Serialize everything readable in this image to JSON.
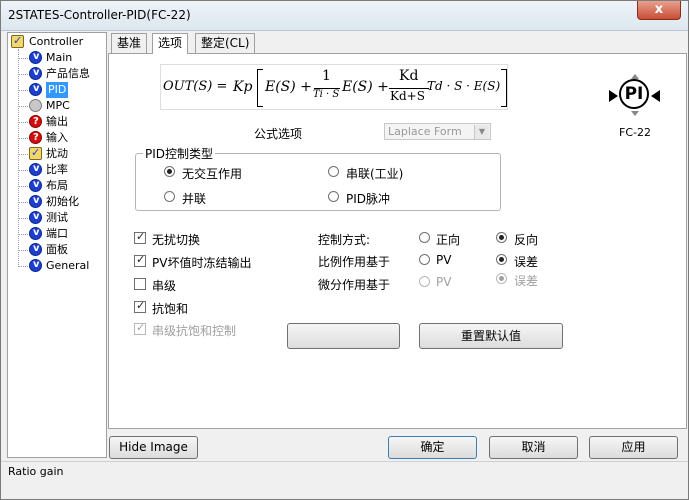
{
  "window": {
    "title": "2STATES-Controller-PID(FC-22)",
    "close_label": "x"
  },
  "tree": {
    "root": "Controller",
    "items": [
      {
        "label": "Main",
        "icon": "check-blue-icon"
      },
      {
        "label": "产品信息",
        "icon": "check-blue-icon"
      },
      {
        "label": "PID",
        "icon": "check-blue-icon",
        "selected": true
      },
      {
        "label": "MPC",
        "icon": "gray-dot-icon"
      },
      {
        "label": "输出",
        "icon": "question-red-icon"
      },
      {
        "label": "输入",
        "icon": "question-red-icon"
      },
      {
        "label": "扰动",
        "icon": "checkbox-icon"
      },
      {
        "label": "比率",
        "icon": "check-blue-icon"
      },
      {
        "label": "布局",
        "icon": "check-blue-icon"
      },
      {
        "label": "初始化",
        "icon": "check-blue-icon"
      },
      {
        "label": "测试",
        "icon": "check-blue-icon"
      },
      {
        "label": "端口",
        "icon": "check-blue-icon"
      },
      {
        "label": "面板",
        "icon": "check-blue-icon"
      },
      {
        "label": "General",
        "icon": "check-blue-icon"
      }
    ]
  },
  "tabs": [
    "基准",
    "选项",
    "整定(CL)"
  ],
  "formula": {
    "lhs": "OUT(S) =",
    "kp": "Kp",
    "e1": "E(S) +",
    "frac1_num": "1",
    "frac1_den": "Ti · S",
    "e2": "E(S) +",
    "frac2_num": "Kd",
    "frac2_den": "Kd+S",
    "tail": "Td · S · E(S)"
  },
  "formula_option": {
    "label": "公式选项",
    "value": "Laplace Form"
  },
  "pid_type": {
    "title": "PID控制类型",
    "options": [
      "无交互作用",
      "串联(工业)",
      "并联",
      "PID脉冲"
    ],
    "selected": "无交互作用"
  },
  "checkboxes": [
    {
      "label": "无扰切换",
      "checked": true,
      "enabled": true
    },
    {
      "label": "PV坏值时冻结输出",
      "checked": true,
      "enabled": true
    },
    {
      "label": "串级",
      "checked": false,
      "enabled": true
    },
    {
      "label": "抗饱和",
      "checked": true,
      "enabled": true
    },
    {
      "label": "串级抗饱和控制",
      "checked": true,
      "enabled": false
    }
  ],
  "control_mode": {
    "label": "控制方式:",
    "opt1": "正向",
    "opt2": "反向",
    "selected": "反向"
  },
  "proportional": {
    "label": "比例作用基于",
    "opt1": "PV",
    "opt2": "误差",
    "selected": "误差"
  },
  "derivative": {
    "label": "微分作用基于",
    "opt1": "PV",
    "opt2": "误差",
    "selected": "误差"
  },
  "buttons": {
    "blank": "",
    "reset": "重置默认值",
    "hide_image": "Hide Image",
    "ok": "确定",
    "cancel": "取消",
    "apply": "应用"
  },
  "device": {
    "symbol": "PI",
    "tag": "FC-22"
  },
  "status": "Ratio gain"
}
